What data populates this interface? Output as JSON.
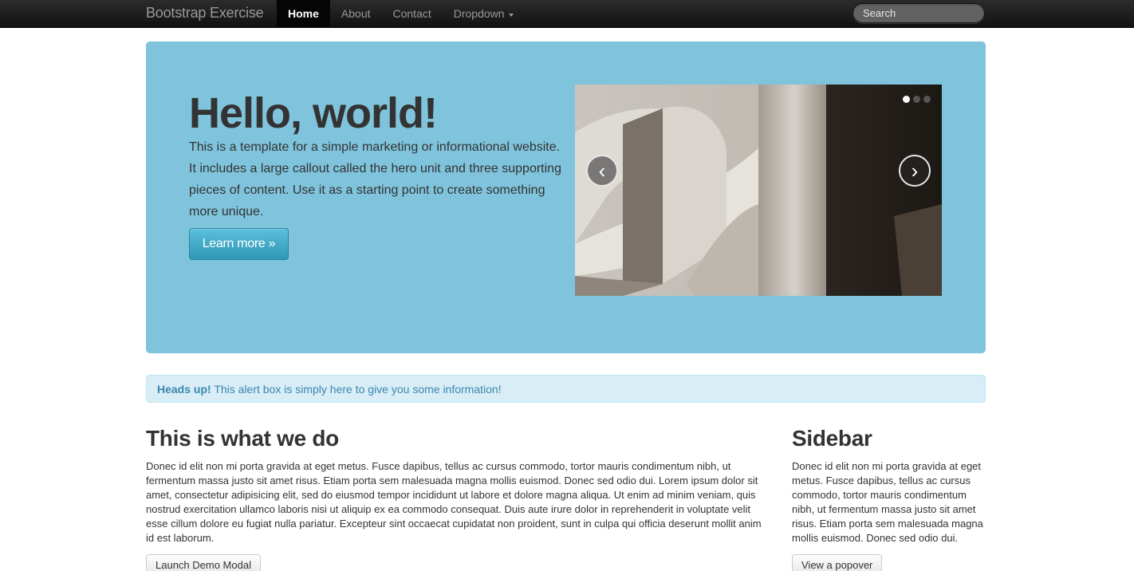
{
  "navbar": {
    "brand": "Bootstrap Exercise",
    "items": [
      {
        "label": "Home",
        "active": true
      },
      {
        "label": "About"
      },
      {
        "label": "Contact"
      },
      {
        "label": "Dropdown"
      }
    ],
    "search_placeholder": "Search"
  },
  "hero": {
    "title": "Hello, world!",
    "text": "This is a template for a simple marketing or informational website. It includes a large callout called the hero unit and three supporting pieces of content. Use it as a starting point to create something more unique.",
    "button": "Learn more »",
    "background_color": "#7fc4dc"
  },
  "carousel": {
    "prev": "‹",
    "next": "›",
    "slide_count": 3,
    "active_slide": 1
  },
  "alert": {
    "strong": "Heads up!",
    "text": " This alert box is simply here to give you some information!"
  },
  "main": {
    "heading": "This is what we do",
    "text": "Donec id elit non mi porta gravida at eget metus. Fusce dapibus, tellus ac cursus commodo, tortor mauris condimentum nibh, ut fermentum massa justo sit amet risus. Etiam porta sem malesuada magna mollis euismod. Donec sed odio dui. Lorem ipsum dolor sit amet, consectetur adipisicing elit, sed do eiusmod tempor incididunt ut labore et dolore magna aliqua. Ut enim ad minim veniam, quis nostrud exercitation ullamco laboris nisi ut aliquip ex ea commodo consequat. Duis aute irure dolor in reprehenderit in voluptate velit esse cillum dolore eu fugiat nulla pariatur. Excepteur sint occaecat cupidatat non proident, sunt in culpa qui officia deserunt mollit anim id est laborum.",
    "button": "Launch Demo Modal"
  },
  "sidebar": {
    "heading": "Sidebar",
    "text": "Donec id elit non mi porta gravida at eget metus. Fusce dapibus, tellus ac cursus commodo, tortor mauris condimentum nibh, ut fermentum massa justo sit amet risus. Etiam porta sem malesuada magna mollis euismod. Donec sed odio dui.",
    "button": "View a popover"
  }
}
